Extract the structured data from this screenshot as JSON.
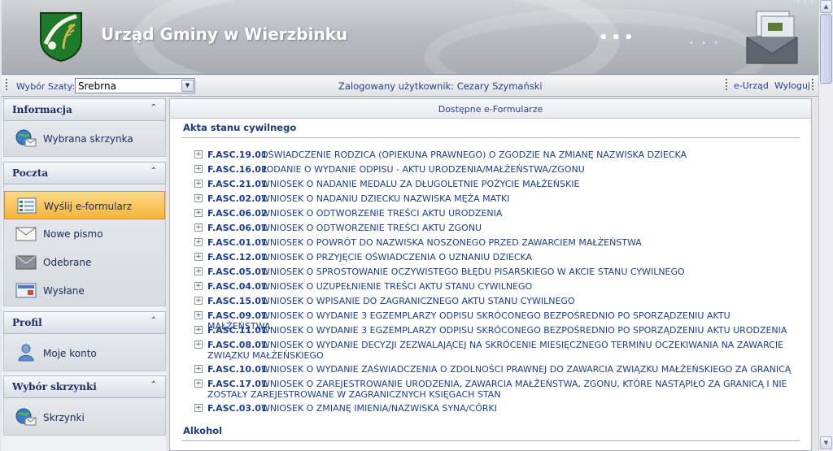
{
  "header": {
    "title": "Urząd Gminy w Wierzbinku",
    "dots_big": "•••",
    "dots_small": "• • •",
    "dots_top": "•••"
  },
  "toolbar": {
    "skin_label": "Wybór Szaty:",
    "skin_value": "Srebrna",
    "logged_user": "Zalogowany użytkownik: Cezary Szymański",
    "eurzad": "e-Urząd",
    "logout": "Wyloguj"
  },
  "sidebar": {
    "sections": [
      {
        "title": "Informacja",
        "items": [
          {
            "label": "Wybrana skrzynka",
            "icon": "globe-mail-icon"
          }
        ]
      },
      {
        "title": "Poczta",
        "items": [
          {
            "label": "Wyślij e-formularz",
            "icon": "form-icon",
            "active": true
          },
          {
            "label": "Nowe pismo",
            "icon": "envelope-open-icon"
          },
          {
            "label": "Odebrane",
            "icon": "envelope-icon"
          },
          {
            "label": "Wysłane",
            "icon": "envelope-sent-icon"
          }
        ]
      },
      {
        "title": "Profil",
        "items": [
          {
            "label": "Moje konto",
            "icon": "user-icon"
          }
        ]
      },
      {
        "title": "Wybór skrzynki",
        "items": [
          {
            "label": "Skrzynki",
            "icon": "globe-mail-icon"
          }
        ]
      }
    ],
    "collapse_glyph": "⌃"
  },
  "main": {
    "title": "Dostępne e-Formularze",
    "categories": [
      {
        "name": "Akta stanu cywilnego",
        "forms": [
          {
            "code": "F.ASC.19.01",
            "name": "OŚWIADCZENIE RODZICA (OPIEKUNA PRAWNEGO) O ZGODZIE NA ZMIANĘ NAZWISKA DZIECKA"
          },
          {
            "code": "F.ASC.16.01",
            "name": "PODANIE O WYDANIE ODPISU - AKTU URODZENIA/MAŁŻEŃSTWA/ZGONU"
          },
          {
            "code": "F.ASC.21.01",
            "name": "WNIOSEK O NADANIE MEDALU ZA DŁUGOLETNIE POŻYCIE MAŁŻEŃSKIE"
          },
          {
            "code": "F.ASC.02.01",
            "name": "WNIOSEK O NADANIU DZIECKU NAZWISKA MĘŻA MATKI"
          },
          {
            "code": "F.ASC.06.02",
            "name": "WNIOSEK O ODTWORZENIE TREŚCI AKTU URODZENIA"
          },
          {
            "code": "F.ASC.06.01",
            "name": "WNIOSEK O ODTWORZENIE TREŚCI AKTU ZGONU"
          },
          {
            "code": "F.ASC.01.01",
            "name": "WNIOSEK O POWRÓT DO NAZWISKA NOSZONEGO PRZED ZAWARCIEM MAŁŻEŃSTWA"
          },
          {
            "code": "F.ASC.12.01",
            "name": "WNIOSEK O PRZYJĘCIE OŚWIADCZENIA O UZNANIU DZIECKA"
          },
          {
            "code": "F.ASC.05.01",
            "name": "WNIOSEK O SPROSTOWANIE OCZYWISTEGO BŁĘDU PISARSKIEGO W AKCIE STANU CYWILNEGO"
          },
          {
            "code": "F.ASC.04.01",
            "name": "WNIOSEK O UZUPEŁNIENIE TREŚCI AKTU STANU CYWILNEGO"
          },
          {
            "code": "F.ASC.15.01",
            "name": "WNIOSEK O WPISANIE DO ZAGRANICZNEGO AKTU STANU CYWILNEGO"
          },
          {
            "code": "F.ASC.09.01",
            "name": "WNIOSEK O WYDANIE 3 EGZEMPLARZY ODPISU SKRÓCONEGO BEZPOŚREDNIO PO SPORZĄDZENIU AKTU MAŁŻEŃSTWA"
          },
          {
            "code": "F.ASC.11.01",
            "name": "WNIOSEK O WYDANIE 3 EGZEMPLARZY ODPISU SKRÓCONEGO BEZPOŚREDNIO PO SPORZĄDZENIU AKTU URODZENIA"
          },
          {
            "code": "F.ASC.08.01",
            "name": "WNIOSEK O WYDANIE DECYZJI ZEZWALAJĄCEJ NA SKRÓCENIE MIESIĘCZNEGO TERMINU OCZEKIWANIA NA ZAWARCIE ZWIĄZKU MAŁŻEŃSKIEGO"
          },
          {
            "code": "F.ASC.10.01",
            "name": "WNIOSEK O WYDANIE ZAŚWIADCZENIA O ZDOLNOŚCI PRAWNEJ DO ZAWARCIA ZWIĄZKU MAŁŻEŃSKIEGO ZA GRANICĄ"
          },
          {
            "code": "F.ASC.17.01",
            "name": "WNIOSEK O ZAREJESTROWANIE URODZENIA, ZAWARCIA MAŁŻEŃSTWA, ZGONU, KTÓRE NASTĄPIŁO ZA GRANICĄ I NIE ZOSTAŁY ZAREJESTROWANE W ZAGRANICZNYCH KSIĘGACH STAN"
          },
          {
            "code": "F.ASC.03.01",
            "name": "WNIOSEK O ZMIANĘ IMIENIA/NAZWISKA SYNA/CÓRKI"
          }
        ]
      },
      {
        "name": "Alkohol",
        "forms": []
      }
    ],
    "expand_glyph": "+"
  },
  "colors": {
    "accent": "#f5b43b",
    "link": "#1c3e8a"
  }
}
